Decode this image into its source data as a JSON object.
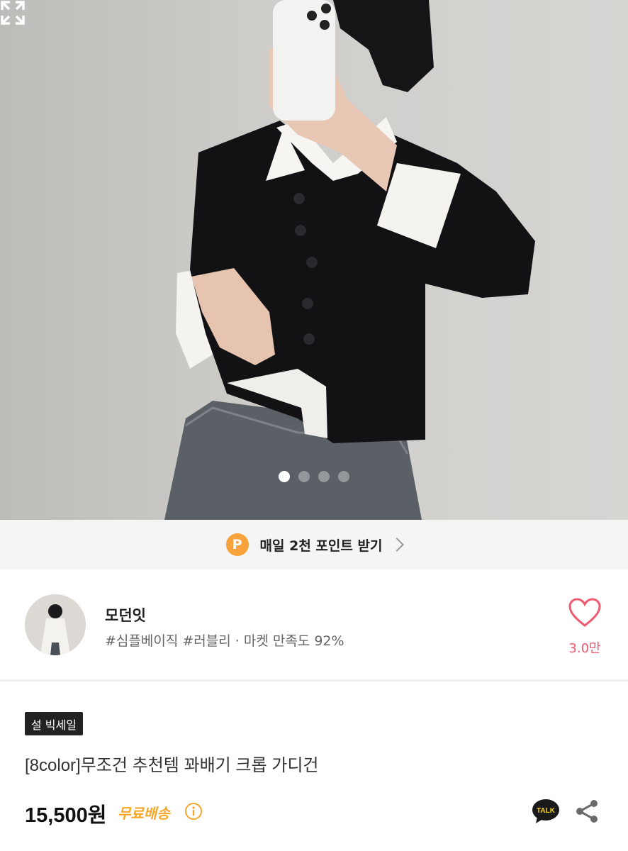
{
  "hero": {
    "image_icon": "product-photo",
    "carousel": {
      "total": 4,
      "active": 1
    },
    "expand_icon": "expand-icon"
  },
  "points_banner": {
    "badge": "P",
    "label": "매일 2천 포인트 받기",
    "badge_color": "#f7a23b"
  },
  "store": {
    "name": "모던잇",
    "tags": "#심플베이직 #러블리 · 마켓 만족도 92%",
    "likes": "3.0만",
    "heart_color": "#ee5a6f"
  },
  "product": {
    "sale_badge": "설 빅세일",
    "title": "[8color]무조건 추천템 꽈배기 크롭 가디건",
    "price": "15,500원",
    "shipping": "무료배송",
    "shipping_color": "#f6a628",
    "talk_label": "TALK"
  }
}
